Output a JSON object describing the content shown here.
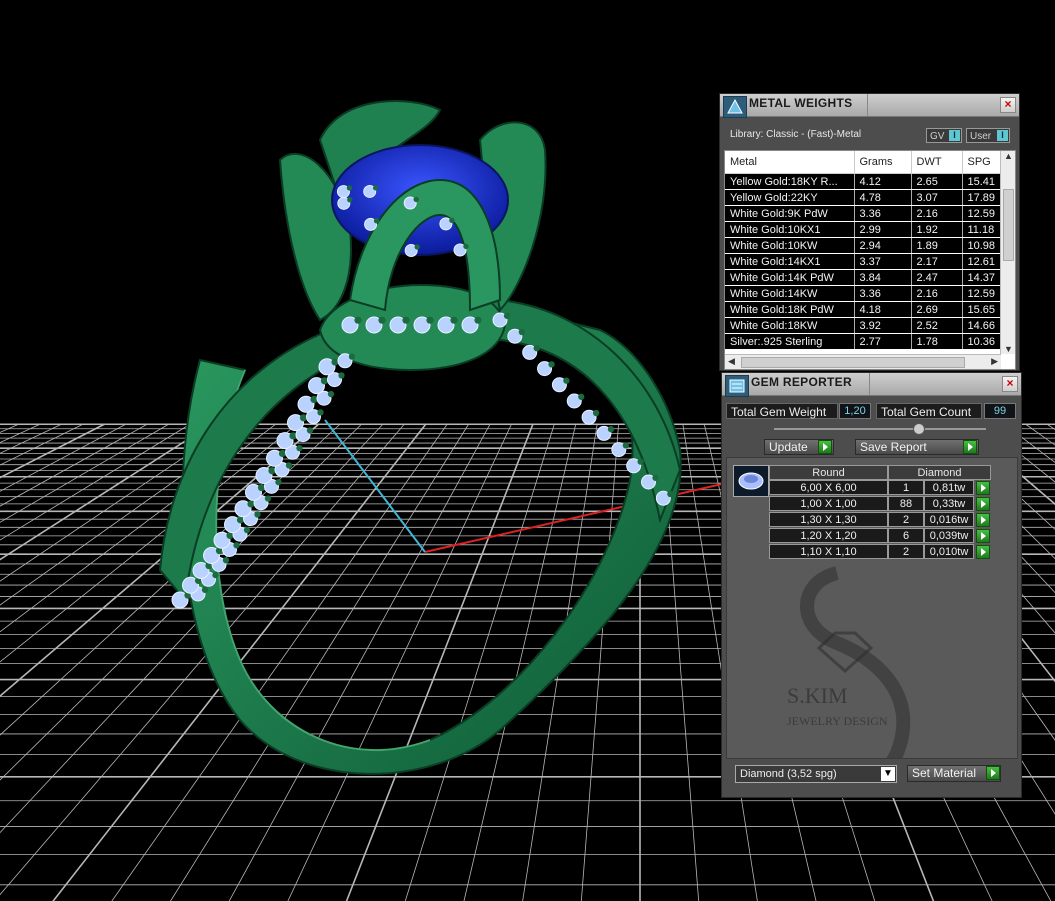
{
  "metal_weights": {
    "title": "METAL WEIGHTS",
    "library": "Library: Classic - (Fast)-Metal",
    "gv_label": "GV",
    "user_label": "User",
    "toggle_glyph": "I",
    "columns": [
      "Metal",
      "Grams",
      "DWT",
      "SPG"
    ],
    "rows": [
      [
        "Yellow Gold:18KY R...",
        "4.12",
        "2.65",
        "15.41"
      ],
      [
        "Yellow Gold:22KY",
        "4.78",
        "3.07",
        "17.89"
      ],
      [
        "White Gold:9K PdW",
        "3.36",
        "2.16",
        "12.59"
      ],
      [
        "White Gold:10KX1",
        "2.99",
        "1.92",
        "11.18"
      ],
      [
        "White Gold:10KW",
        "2.94",
        "1.89",
        "10.98"
      ],
      [
        "White Gold:14KX1",
        "3.37",
        "2.17",
        "12.61"
      ],
      [
        "White Gold:14K PdW",
        "3.84",
        "2.47",
        "14.37"
      ],
      [
        "White Gold:14KW",
        "3.36",
        "2.16",
        "12.59"
      ],
      [
        "White Gold:18K PdW",
        "4.18",
        "2.69",
        "15.65"
      ],
      [
        "White Gold:18KW",
        "3.92",
        "2.52",
        "14.66"
      ],
      [
        "Silver:.925 Sterling",
        "2.77",
        "1.78",
        "10.36"
      ]
    ]
  },
  "gem_reporter": {
    "title": "GEM REPORTER",
    "total_gem_weight_label": "Total Gem Weight",
    "total_gem_weight_value": "1,20",
    "total_gem_count_label": "Total Gem Count",
    "total_gem_count_value": "99",
    "update_label": "Update",
    "save_report_label": "Save Report",
    "shape_header": "Round",
    "material_header": "Diamond",
    "rows": [
      [
        "6,00 X 6,00",
        "1",
        "0,81tw"
      ],
      [
        "1,00 X 1,00",
        "88",
        "0,33tw"
      ],
      [
        "1,30 X 1,30",
        "2",
        "0,016tw"
      ],
      [
        "1,20 X 1,20",
        "6",
        "0,039tw"
      ],
      [
        "1,10 X 1,10",
        "2",
        "0,010tw"
      ]
    ],
    "material_select": "Diamond    (3,52 spg)",
    "set_material_label": "Set Material",
    "watermark_brand": "S.KIM",
    "watermark_sub": "JEWELRY DESIGN"
  }
}
